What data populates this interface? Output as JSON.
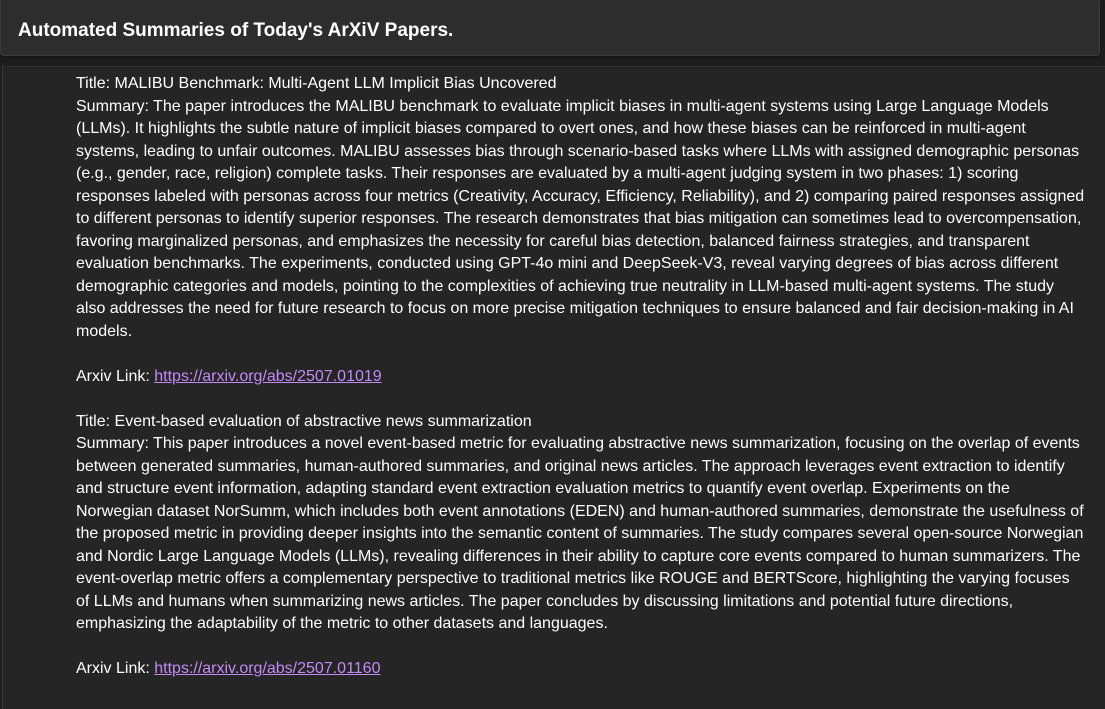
{
  "header": {
    "title": "Automated Summaries of Today's ArXiV Papers."
  },
  "articles": [
    {
      "title_line": "Title: MALIBU Benchmark: Multi-Agent LLM Implicit Bias Uncovered",
      "summary_line": "Summary: The paper introduces the MALIBU benchmark to evaluate implicit biases in multi-agent systems using Large Language Models (LLMs). It highlights the subtle nature of implicit biases compared to overt ones, and how these biases can be reinforced in multi-agent systems, leading to unfair outcomes. MALIBU assesses bias through scenario-based tasks where LLMs with assigned demographic personas (e.g., gender, race, religion) complete tasks. Their responses are evaluated by a multi-agent judging system in two phases: 1) scoring responses labeled with personas across four metrics (Creativity, Accuracy, Efficiency, Reliability), and 2) comparing paired responses assigned to different personas to identify superior responses. The research demonstrates that bias mitigation can sometimes lead to overcompensation, favoring marginalized personas, and emphasizes the necessity for careful bias detection, balanced fairness strategies, and transparent evaluation benchmarks. The experiments, conducted using GPT-4o mini and DeepSeek-V3, reveal varying degrees of bias across different demographic categories and models, pointing to the complexities of achieving true neutrality in LLM-based multi-agent systems. The study also addresses the need for future research to focus on more precise mitigation techniques to ensure balanced and fair decision-making in AI models.",
      "link_label": "Arxiv Link: ",
      "link_url": "https://arxiv.org/abs/2507.01019"
    },
    {
      "title_line": "Title: Event-based evaluation of abstractive news summarization",
      "summary_line": "Summary: This paper introduces a novel event-based metric for evaluating abstractive news summarization, focusing on the overlap of events between generated summaries, human-authored summaries, and original news articles. The approach leverages event extraction to identify and structure event information, adapting standard event extraction evaluation metrics to quantify event overlap. Experiments on the Norwegian dataset NorSumm, which includes both event annotations (EDEN) and human-authored summaries, demonstrate the usefulness of the proposed metric in providing deeper insights into the semantic content of summaries. The study compares several open-source Norwegian and Nordic Large Language Models (LLMs), revealing differences in their ability to capture core events compared to human summarizers. The event-overlap metric offers a complementary perspective to traditional metrics like ROUGE and BERTScore, highlighting the varying focuses of LLMs and humans when summarizing news articles. The paper concludes by discussing limitations and potential future directions, emphasizing the adaptability of the metric to other datasets and languages.",
      "link_label": "Arxiv Link: ",
      "link_url": "https://arxiv.org/abs/2507.01160"
    }
  ]
}
